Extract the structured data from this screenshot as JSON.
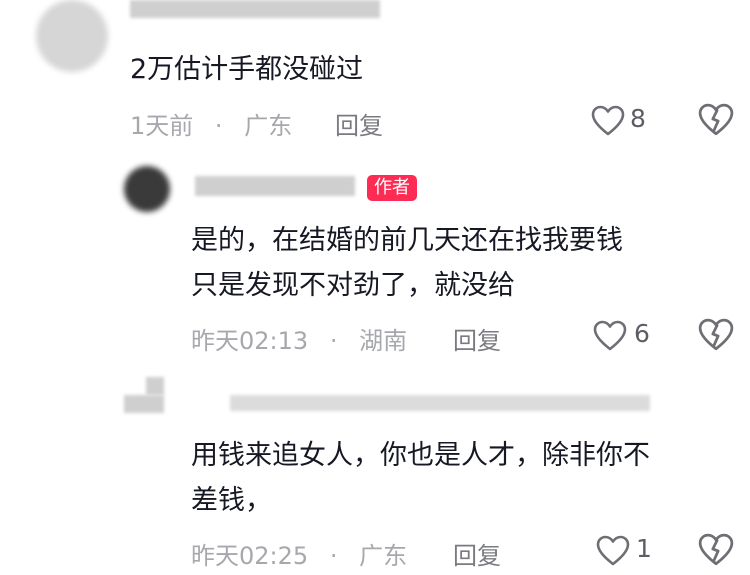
{
  "comments": [
    {
      "text_lines": [
        "2万估计手都没碰过"
      ],
      "time": "1天前",
      "sep": "·",
      "location": "广东",
      "reply_label": "回复",
      "likes": "8",
      "author_tag": ""
    },
    {
      "text_lines": [
        "是的，在结婚的前几天还在找我要钱",
        "只是发现不对劲了，就没给"
      ],
      "time": "昨天02:13",
      "sep": "·",
      "location": "湖南",
      "reply_label": "回复",
      "likes": "6",
      "author_tag": "作者"
    },
    {
      "text_lines": [
        "用钱来追女人，你也是人才，除非你不",
        "差钱，"
      ],
      "time": "昨天02:25",
      "sep": "·",
      "location": "广东",
      "reply_label": "回复",
      "likes": "1",
      "author_tag": ""
    }
  ],
  "colors": {
    "accent": "#fe2c55",
    "text": "#161823",
    "meta": "#a7a8ad"
  },
  "icons": [
    "heart-outline-icon",
    "broken-heart-icon"
  ]
}
